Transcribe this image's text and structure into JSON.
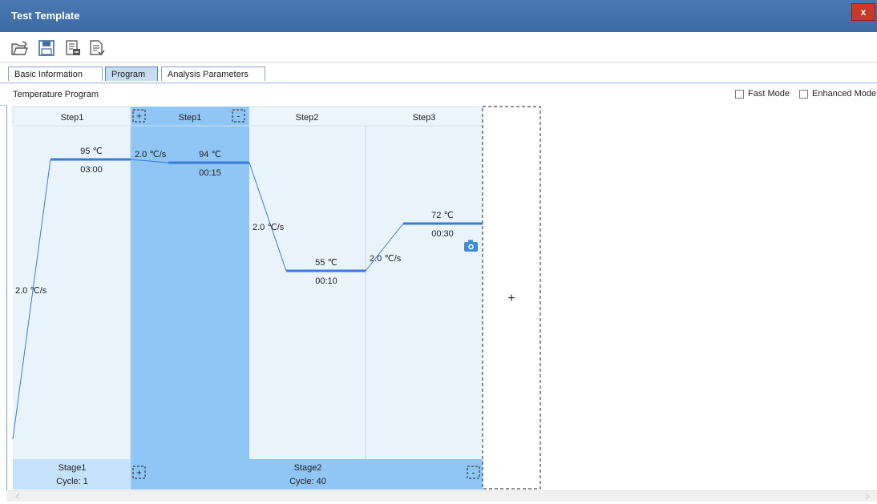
{
  "window": {
    "title": "Test Template",
    "close_label": "x"
  },
  "toolbar": {
    "buttons": [
      "open-icon",
      "save-icon",
      "export-icon",
      "import-icon"
    ]
  },
  "tabs": [
    {
      "label": "Basic Information",
      "active": false
    },
    {
      "label": "Program",
      "active": true
    },
    {
      "label": "Analysis Parameters",
      "active": false
    }
  ],
  "section": {
    "title": "Temperature Program",
    "fast_mode_label": "Fast Mode",
    "enhanced_mode_label": "Enhanced Mode"
  },
  "program": {
    "colors": {
      "selected_stage": "#8fc6f5",
      "stage_bg": "#eaf4fd",
      "footer_bg": "#c6e2fb",
      "line": "#3a7bd5"
    },
    "stages": [
      {
        "name": "Stage1",
        "cycle_label": "Cycle: 1",
        "selected": false,
        "steps": [
          {
            "name": "Step1",
            "temperature": 95,
            "temperature_label": "95 ℃",
            "time": "03:00",
            "rate": "2.0 ℃/s",
            "camera": false
          }
        ]
      },
      {
        "name": "Stage2",
        "cycle_label": "Cycle: 40",
        "selected": true,
        "steps": [
          {
            "name": "Step1",
            "temperature": 94,
            "temperature_label": "94 ℃",
            "time": "00:15",
            "rate": "2.0 ℃/s",
            "camera": false
          },
          {
            "name": "Step2",
            "temperature": 55,
            "temperature_label": "55 ℃",
            "time": "00:10",
            "rate": "2.0 ℃/s",
            "camera": false
          },
          {
            "name": "Step3",
            "temperature": 72,
            "temperature_label": "72 ℃",
            "time": "00:30",
            "rate": "2.0 ℃/s",
            "camera": true
          }
        ]
      }
    ],
    "add_stage_label": "+",
    "add_step_label": "+",
    "remove_step_label": "-"
  }
}
